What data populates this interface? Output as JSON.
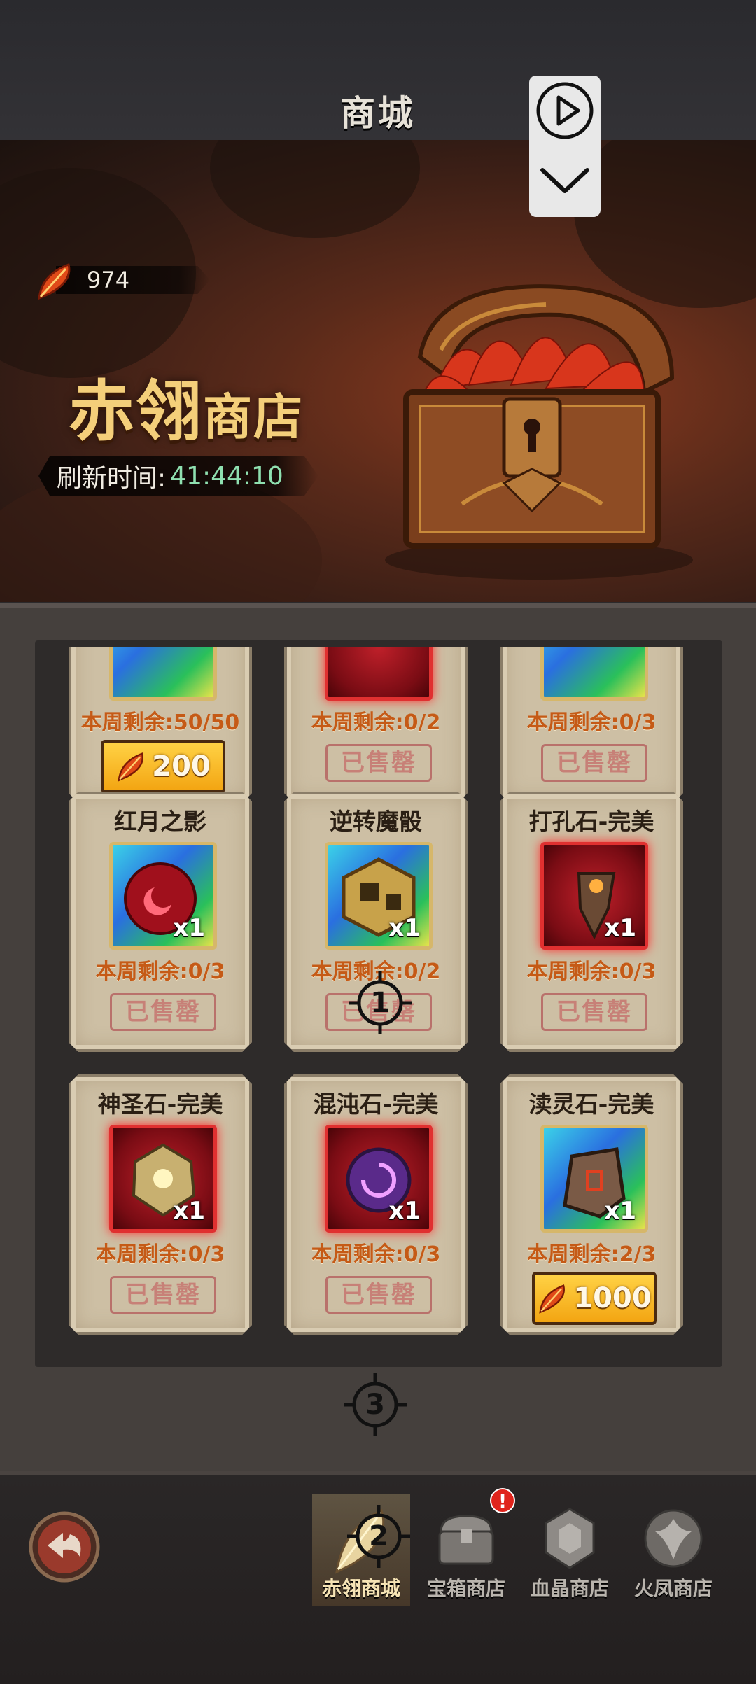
{
  "header": {
    "title": "商城"
  },
  "recorder": {
    "play_icon": "play-circle-icon",
    "collapse_icon": "chevron-down-icon"
  },
  "banner": {
    "currency_value": "974",
    "shop_title_main": "赤翎",
    "shop_title_sub": "商店",
    "refresh_label": "刷新时间:",
    "refresh_value": "41:44:10"
  },
  "items": [
    {
      "name": "",
      "qty": "",
      "remain": "本周剩余:50/50",
      "status": "buy",
      "price": "200",
      "color": "rare"
    },
    {
      "name": "",
      "qty": "",
      "remain": "本周剩余:0/2",
      "status": "sold",
      "sold_label": "已售罄",
      "color": "red"
    },
    {
      "name": "",
      "qty": "",
      "remain": "本周剩余:0/3",
      "status": "sold",
      "sold_label": "已售罄",
      "color": "rare"
    },
    {
      "name": "红月之影",
      "qty": "x1",
      "remain": "本周剩余:0/3",
      "status": "sold",
      "sold_label": "已售罄",
      "color": "rare"
    },
    {
      "name": "逆转魔骰",
      "qty": "x1",
      "remain": "本周剩余:0/2",
      "status": "sold",
      "sold_label": "已售罄",
      "color": "rare"
    },
    {
      "name": "打孔石-完美",
      "qty": "x1",
      "remain": "本周剩余:0/3",
      "status": "sold",
      "sold_label": "已售罄",
      "color": "red"
    },
    {
      "name": "神圣石-完美",
      "qty": "x1",
      "remain": "本周剩余:0/3",
      "status": "sold",
      "sold_label": "已售罄",
      "color": "red"
    },
    {
      "name": "混沌石-完美",
      "qty": "x1",
      "remain": "本周剩余:0/3",
      "status": "sold",
      "sold_label": "已售罄",
      "color": "red"
    },
    {
      "name": "渎灵石-完美",
      "qty": "x1",
      "remain": "本周剩余:2/3",
      "status": "buy",
      "price": "1000",
      "color": "rare"
    }
  ],
  "markers": {
    "m1": "1",
    "m2": "2",
    "m3": "3"
  },
  "nav": {
    "tabs": [
      {
        "label": "赤翎商城",
        "active": true
      },
      {
        "label": "宝箱商店",
        "active": false
      },
      {
        "label": "血晶商店",
        "active": false
      },
      {
        "label": "火凤商店",
        "active": false
      }
    ],
    "notify_badge": "!"
  },
  "colors": {
    "accent_gold": "#f3a512",
    "remain_orange": "#c55a16",
    "timer_green": "#8fe0b0"
  }
}
